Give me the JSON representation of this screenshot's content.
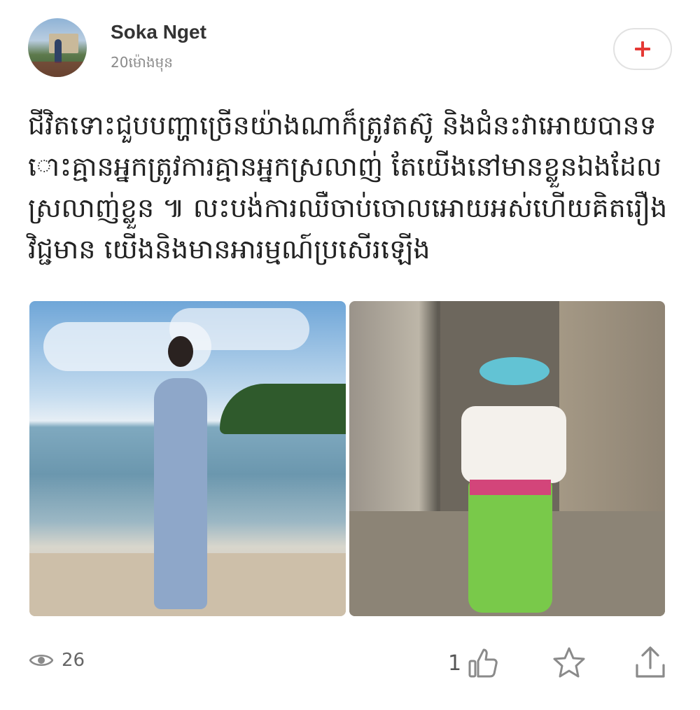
{
  "post": {
    "author": "Soka Nget",
    "time": "20ម៉ោងមុន",
    "text": "ជីវិតទោះជួបបញ្ហាច្រើនយ៉ាងណាក៏ត្រូវតស៊ូ និងជំនះវាអោយបានទោះគ្មានអ្នកត្រូវការគ្មានអ្នកស្រលាញ់ តែយើងនៅមានខ្លួនឯងដែលស្រលាញ់ខ្លួន ៕ លះបង់ការឈឺចាប់ចោលអោយអស់ហើយគិតរឿងវិជ្ជមាន យើងនិងមានអារម្មណ៍ប្រសើរឡើង"
  },
  "stats": {
    "views": "26",
    "likes": "1"
  },
  "icons": {
    "follow": "plus-icon",
    "views": "eye-icon",
    "like": "thumbs-up-icon",
    "favorite": "star-icon",
    "share": "share-icon"
  },
  "colors": {
    "accent": "#e53935",
    "icon": "#8a8a8a"
  }
}
